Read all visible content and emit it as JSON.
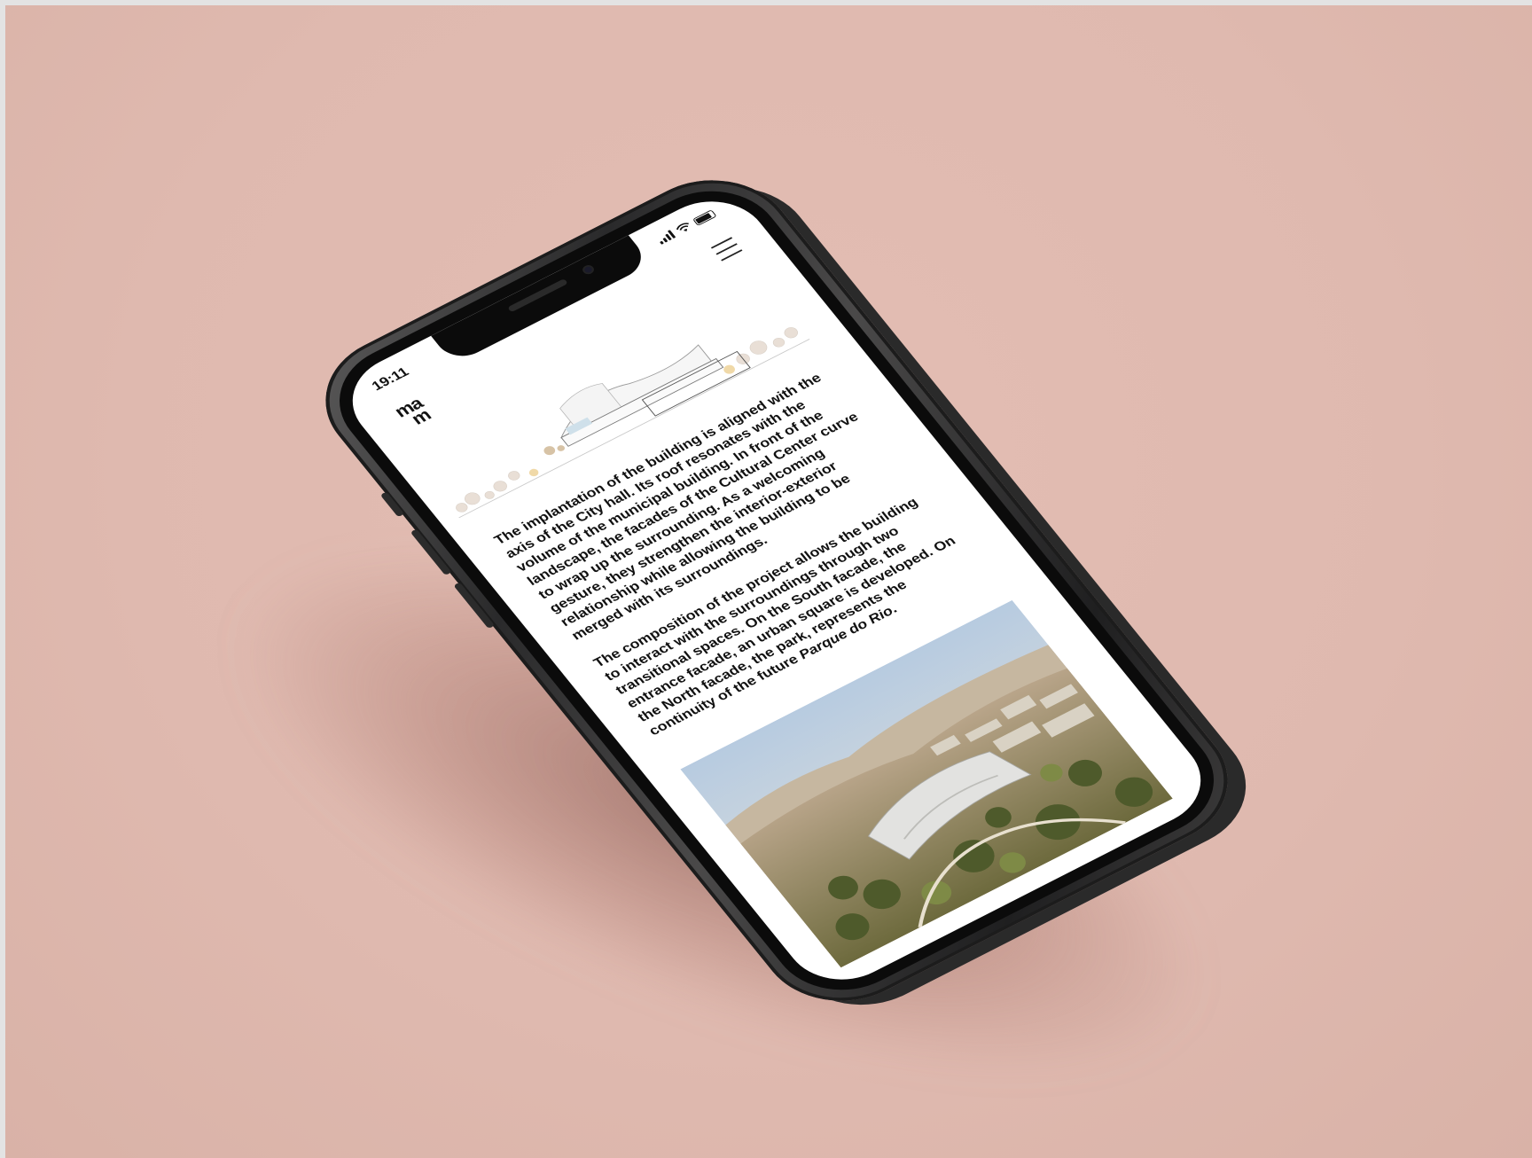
{
  "status_bar": {
    "time": "19:11"
  },
  "header": {
    "logo_text": "ma\nm",
    "menu_icon": "hamburger-menu-icon"
  },
  "article": {
    "paragraph_1": "The implantation of the building is aligned with the axis of the City hall. Its roof resonates with the volume of the municipal building. In front of the landscape, the facades of the Cultural Center curve to wrap up the surrounding. As a welcoming gesture, they strengthen the interior-exterior relationship while allowing the building to be merged with its surroundings.",
    "paragraph_2_main": "The composition of the project allows the building to interact with the surroundings through two transitional spaces. On the South facade, the entrance facade, an urban square is developed. On the North facade, the park, represents the continuity of the future ",
    "paragraph_2_italic": "Parque do Rio",
    "paragraph_2_end": "."
  },
  "colors": {
    "background": "#dfb9af",
    "phone_frame": "#2a2a2b",
    "screen": "#ffffff",
    "text": "#111111"
  }
}
